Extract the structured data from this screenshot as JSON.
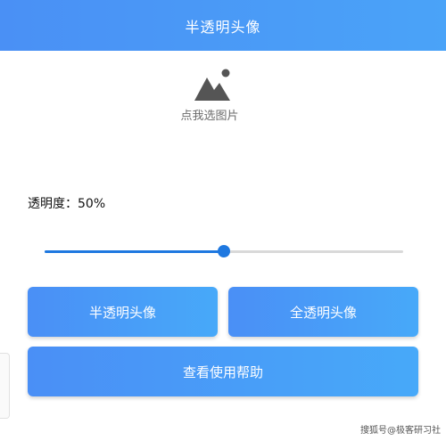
{
  "header": {
    "title": "半透明头像"
  },
  "image_picker": {
    "icon": "image-placeholder-icon",
    "label": "点我选图片"
  },
  "opacity": {
    "label": "透明度：",
    "value_text": "50%",
    "value": 0.5
  },
  "buttons": {
    "half_transparent": "半透明头像",
    "full_transparent": "全透明头像",
    "help": "查看使用帮助"
  },
  "watermark": "搜狐号@极客研习社",
  "colors": {
    "header_start": "#4a90f5",
    "header_end": "#4aa3f8",
    "slider_active": "#1e78e0",
    "slider_track": "#d9d9d9",
    "button_start": "#4a8ff6",
    "button_end": "#47a9f9"
  }
}
